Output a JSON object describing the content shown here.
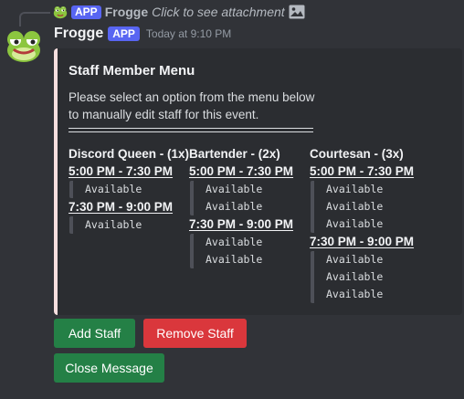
{
  "reply": {
    "author": "Frogge",
    "badge": "APP",
    "text": "Click to see attachment"
  },
  "message": {
    "author": "Frogge",
    "badge": "APP",
    "timestamp": "Today at 9:10 PM"
  },
  "embed": {
    "accent_color": "#f7dfdf",
    "title": "Staff Member Menu",
    "description_line1": "Please select an option from the menu below",
    "description_line2": "to manually edit staff for this event.",
    "fields": [
      {
        "name": "Discord Queen - (1x)",
        "slots": [
          {
            "time": "5:00 PM - 7:30 PM",
            "entries": [
              "Available"
            ]
          },
          {
            "time": "7:30 PM - 9:00 PM",
            "entries": [
              "Available"
            ]
          }
        ]
      },
      {
        "name": "Bartender - (2x)",
        "slots": [
          {
            "time": "5:00 PM - 7:30 PM",
            "entries": [
              "Available",
              "Available"
            ]
          },
          {
            "time": "7:30 PM - 9:00 PM",
            "entries": [
              "Available",
              "Available"
            ]
          }
        ]
      },
      {
        "name": "Courtesan - (3x)",
        "slots": [
          {
            "time": "5:00 PM - 7:30 PM",
            "entries": [
              "Available",
              "Available",
              "Available"
            ]
          },
          {
            "time": "7:30 PM - 9:00 PM",
            "entries": [
              "Available",
              "Available",
              "Available"
            ]
          }
        ]
      }
    ]
  },
  "buttons": {
    "add_staff": "Add Staff",
    "remove_staff": "Remove Staff",
    "close_message": "Close Message"
  },
  "icons": {
    "reply_avatar": "frog-avatar-icon",
    "attachment": "image-icon",
    "avatar": "frog-avatar-icon"
  },
  "colors": {
    "background": "#313338",
    "embed_background": "#2b2d31",
    "app_badge": "#5865f2",
    "button_success": "#248046",
    "button_danger": "#da373c"
  }
}
